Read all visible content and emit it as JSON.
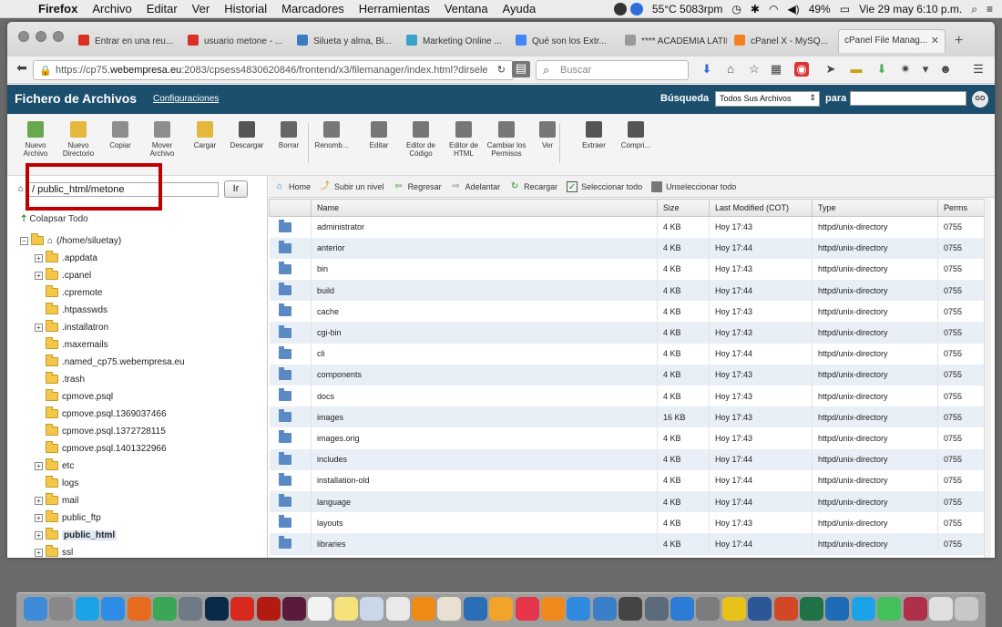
{
  "menubar": {
    "items": [
      "Firefox",
      "Archivo",
      "Editar",
      "Ver",
      "Historial",
      "Marcadores",
      "Herramientas",
      "Ventana",
      "Ayuda"
    ],
    "temp": "55°C 5083rpm",
    "battery": "49%",
    "datetime": "Vie 29 may  6:10 p.m."
  },
  "tabs": [
    {
      "label": "Entrar en una reu...",
      "icon": "gmail-icon",
      "color": "#d93025"
    },
    {
      "label": "usuario metone - ...",
      "icon": "gmail-icon",
      "color": "#d93025"
    },
    {
      "label": "Silueta y alma, Bi...",
      "icon": "blog-icon",
      "color": "#3b7bbf"
    },
    {
      "label": "Marketing Online ...",
      "icon": "m-icon",
      "color": "#36a4c8"
    },
    {
      "label": "Qué son los Extr...",
      "icon": "google-icon",
      "color": "#4285f4"
    },
    {
      "label": "**** ACADEMIA LATIN...",
      "icon": "page-icon",
      "color": "#999999"
    },
    {
      "label": "cPanel X - MySQ...",
      "icon": "cpanel-icon",
      "color": "#f48120"
    },
    {
      "label": "cPanel File Manag...",
      "icon": "",
      "color": "",
      "active": true
    }
  ],
  "urlbar": {
    "prefix": "https://cp75.",
    "domain": "webempresa.eu",
    "rest": ":2083/cpsess4830620846/frontend/x3/filemanager/index.html?dirsele"
  },
  "searchbar": {
    "placeholder": "Buscar"
  },
  "cpanel": {
    "title": "Fichero de Archivos",
    "config_link": "Configuraciones",
    "search_label": "Búsqueda",
    "search_scope": "Todos Sus Archivos",
    "para_label": "para",
    "go_label": "GO"
  },
  "tools": [
    {
      "label": "Nuevo Archivo",
      "icon": "new-file-icon",
      "color": "#6aa84f"
    },
    {
      "label": "Nuevo Directorio",
      "icon": "new-folder-icon",
      "color": "#e6b73d"
    },
    {
      "label": "Copiar",
      "icon": "copy-icon",
      "color": "#8d8d8d"
    },
    {
      "label": "Mover Archivo",
      "icon": "move-icon",
      "color": "#8d8d8d"
    },
    {
      "label": "Cargar",
      "icon": "upload-icon",
      "color": "#e6b73d"
    },
    {
      "label": "Descargar",
      "icon": "download-icon",
      "color": "#555555"
    },
    {
      "label": "Borrar",
      "icon": "delete-icon",
      "color": "#666666"
    },
    {
      "label": "Renomb...",
      "icon": "rename-icon",
      "color": "#777777"
    },
    {
      "label": "Editar",
      "icon": "edit-icon",
      "color": "#777777"
    },
    {
      "label": "Editor de Código",
      "icon": "code-editor-icon",
      "color": "#777777"
    },
    {
      "label": "Editor de HTML",
      "icon": "html-editor-icon",
      "color": "#777777"
    },
    {
      "label": "Cambiar los Permisos",
      "icon": "permissions-icon",
      "color": "#777777"
    },
    {
      "label": "Ver",
      "icon": "view-icon",
      "color": "#777777"
    },
    {
      "label": "Extraer",
      "icon": "extract-icon",
      "color": "#555555"
    },
    {
      "label": "Compri...",
      "icon": "compress-icon",
      "color": "#555555"
    }
  ],
  "path": {
    "value": "/ public_html/metone",
    "go_label": "Ir"
  },
  "tree": {
    "collapse_label": "Colapsar Todo",
    "root": "(/home/siluetay)",
    "items": [
      {
        "label": ".appdata",
        "expandable": true
      },
      {
        "label": ".cpanel",
        "expandable": true
      },
      {
        "label": ".cpremote",
        "expandable": false
      },
      {
        "label": ".htpasswds",
        "expandable": false
      },
      {
        "label": ".installatron",
        "expandable": true
      },
      {
        "label": ".maxemails",
        "expandable": false
      },
      {
        "label": ".named_cp75.webempresa.eu",
        "expandable": false
      },
      {
        "label": ".trash",
        "expandable": false
      },
      {
        "label": "cpmove.psql",
        "expandable": false
      },
      {
        "label": "cpmove.psql.1369037466",
        "expandable": false
      },
      {
        "label": "cpmove.psql.1372728115",
        "expandable": false
      },
      {
        "label": "cpmove.psql.1401322966",
        "expandable": false
      },
      {
        "label": "etc",
        "expandable": true
      },
      {
        "label": "logs",
        "expandable": false
      },
      {
        "label": "mail",
        "expandable": true
      },
      {
        "label": "public_ftp",
        "expandable": true
      },
      {
        "label": "public_html",
        "expandable": true,
        "selected": true
      },
      {
        "label": "ssl",
        "expandable": true
      }
    ]
  },
  "navrow": {
    "home": "Home",
    "up": "Subir un nivel",
    "back": "Regresar",
    "forward": "Adelantar",
    "reload": "Recargar",
    "select_all": "Seleccionar todo",
    "deselect_all": "Unseleccionar todo"
  },
  "table": {
    "headers": [
      "Name",
      "Size",
      "Last Modified (COT)",
      "Type",
      "Perms"
    ],
    "rows": [
      [
        "administrator",
        "4 KB",
        "Hoy 17:43",
        "httpd/unix-directory",
        "0755"
      ],
      [
        "anterior",
        "4 KB",
        "Hoy 17:44",
        "httpd/unix-directory",
        "0755"
      ],
      [
        "bin",
        "4 KB",
        "Hoy 17:43",
        "httpd/unix-directory",
        "0755"
      ],
      [
        "build",
        "4 KB",
        "Hoy 17:44",
        "httpd/unix-directory",
        "0755"
      ],
      [
        "cache",
        "4 KB",
        "Hoy 17:43",
        "httpd/unix-directory",
        "0755"
      ],
      [
        "cgi-bin",
        "4 KB",
        "Hoy 17:43",
        "httpd/unix-directory",
        "0755"
      ],
      [
        "cli",
        "4 KB",
        "Hoy 17:44",
        "httpd/unix-directory",
        "0755"
      ],
      [
        "components",
        "4 KB",
        "Hoy 17:43",
        "httpd/unix-directory",
        "0755"
      ],
      [
        "docs",
        "4 KB",
        "Hoy 17:43",
        "httpd/unix-directory",
        "0755"
      ],
      [
        "images",
        "16 KB",
        "Hoy 17:43",
        "httpd/unix-directory",
        "0755"
      ],
      [
        "images.orig",
        "4 KB",
        "Hoy 17:43",
        "httpd/unix-directory",
        "0755"
      ],
      [
        "includes",
        "4 KB",
        "Hoy 17:44",
        "httpd/unix-directory",
        "0755"
      ],
      [
        "installation-old",
        "4 KB",
        "Hoy 17:44",
        "httpd/unix-directory",
        "0755"
      ],
      [
        "language",
        "4 KB",
        "Hoy 17:44",
        "httpd/unix-directory",
        "0755"
      ],
      [
        "layouts",
        "4 KB",
        "Hoy 17:43",
        "httpd/unix-directory",
        "0755"
      ],
      [
        "libraries",
        "4 KB",
        "Hoy 17:44",
        "httpd/unix-directory",
        "0755"
      ]
    ]
  },
  "dock": {
    "apps": [
      {
        "icon": "finder-icon",
        "color": "#3d8bd9"
      },
      {
        "icon": "launchpad-icon",
        "color": "#888888"
      },
      {
        "icon": "skype-icon",
        "color": "#1aa3e8"
      },
      {
        "icon": "safari-icon",
        "color": "#2e8be6"
      },
      {
        "icon": "firefox-icon",
        "color": "#e66b1f"
      },
      {
        "icon": "chrome-icon",
        "color": "#3aa757"
      },
      {
        "icon": "scanner-icon",
        "color": "#6f7a86"
      },
      {
        "icon": "photoshop-icon",
        "color": "#0b2a4a"
      },
      {
        "icon": "acrobat-icon",
        "color": "#d9281c"
      },
      {
        "icon": "acrobat-pro-icon",
        "color": "#b51a12"
      },
      {
        "icon": "indesign-icon",
        "color": "#5a1a3c"
      },
      {
        "icon": "calendar-icon",
        "color": "#f2f2f2"
      },
      {
        "icon": "notes-icon",
        "color": "#f5e27a"
      },
      {
        "icon": "preview-icon",
        "color": "#c9d7e8"
      },
      {
        "icon": "script-icon",
        "color": "#e9e9e9"
      },
      {
        "icon": "vlc-icon",
        "color": "#ef8a13"
      },
      {
        "icon": "photos-icon",
        "color": "#e8e0d0"
      },
      {
        "icon": "quicktime-icon",
        "color": "#2a6fb5"
      },
      {
        "icon": "amazon-icon",
        "color": "#f0a52a"
      },
      {
        "icon": "music-icon",
        "color": "#e6344a"
      },
      {
        "icon": "ibooks-icon",
        "color": "#f08a1c"
      },
      {
        "icon": "appstore-icon",
        "color": "#2f8ae0"
      },
      {
        "icon": "migration-icon",
        "color": "#3c7fc9"
      },
      {
        "icon": "movie-icon",
        "color": "#444444"
      },
      {
        "icon": "screen-icon",
        "color": "#5c6b7a"
      },
      {
        "icon": "download-app-icon",
        "color": "#2c7bd6"
      },
      {
        "icon": "sysprefs-icon",
        "color": "#7c7c7c"
      },
      {
        "icon": "radiation-icon",
        "color": "#e8c21a"
      },
      {
        "icon": "word-icon",
        "color": "#2b5797"
      },
      {
        "icon": "powerpoint-icon",
        "color": "#d24726"
      },
      {
        "icon": "excel-icon",
        "color": "#1f7246"
      },
      {
        "icon": "outlook-icon",
        "color": "#1f6cb6"
      },
      {
        "icon": "skype2-icon",
        "color": "#1aa3e8"
      },
      {
        "icon": "facetime-icon",
        "color": "#43c05a"
      },
      {
        "icon": "photobooth-icon",
        "color": "#b0304a"
      },
      {
        "icon": "documents-icon",
        "color": "#e0e0e0"
      },
      {
        "icon": "trash-icon",
        "color": "#c8c8c8"
      }
    ]
  }
}
